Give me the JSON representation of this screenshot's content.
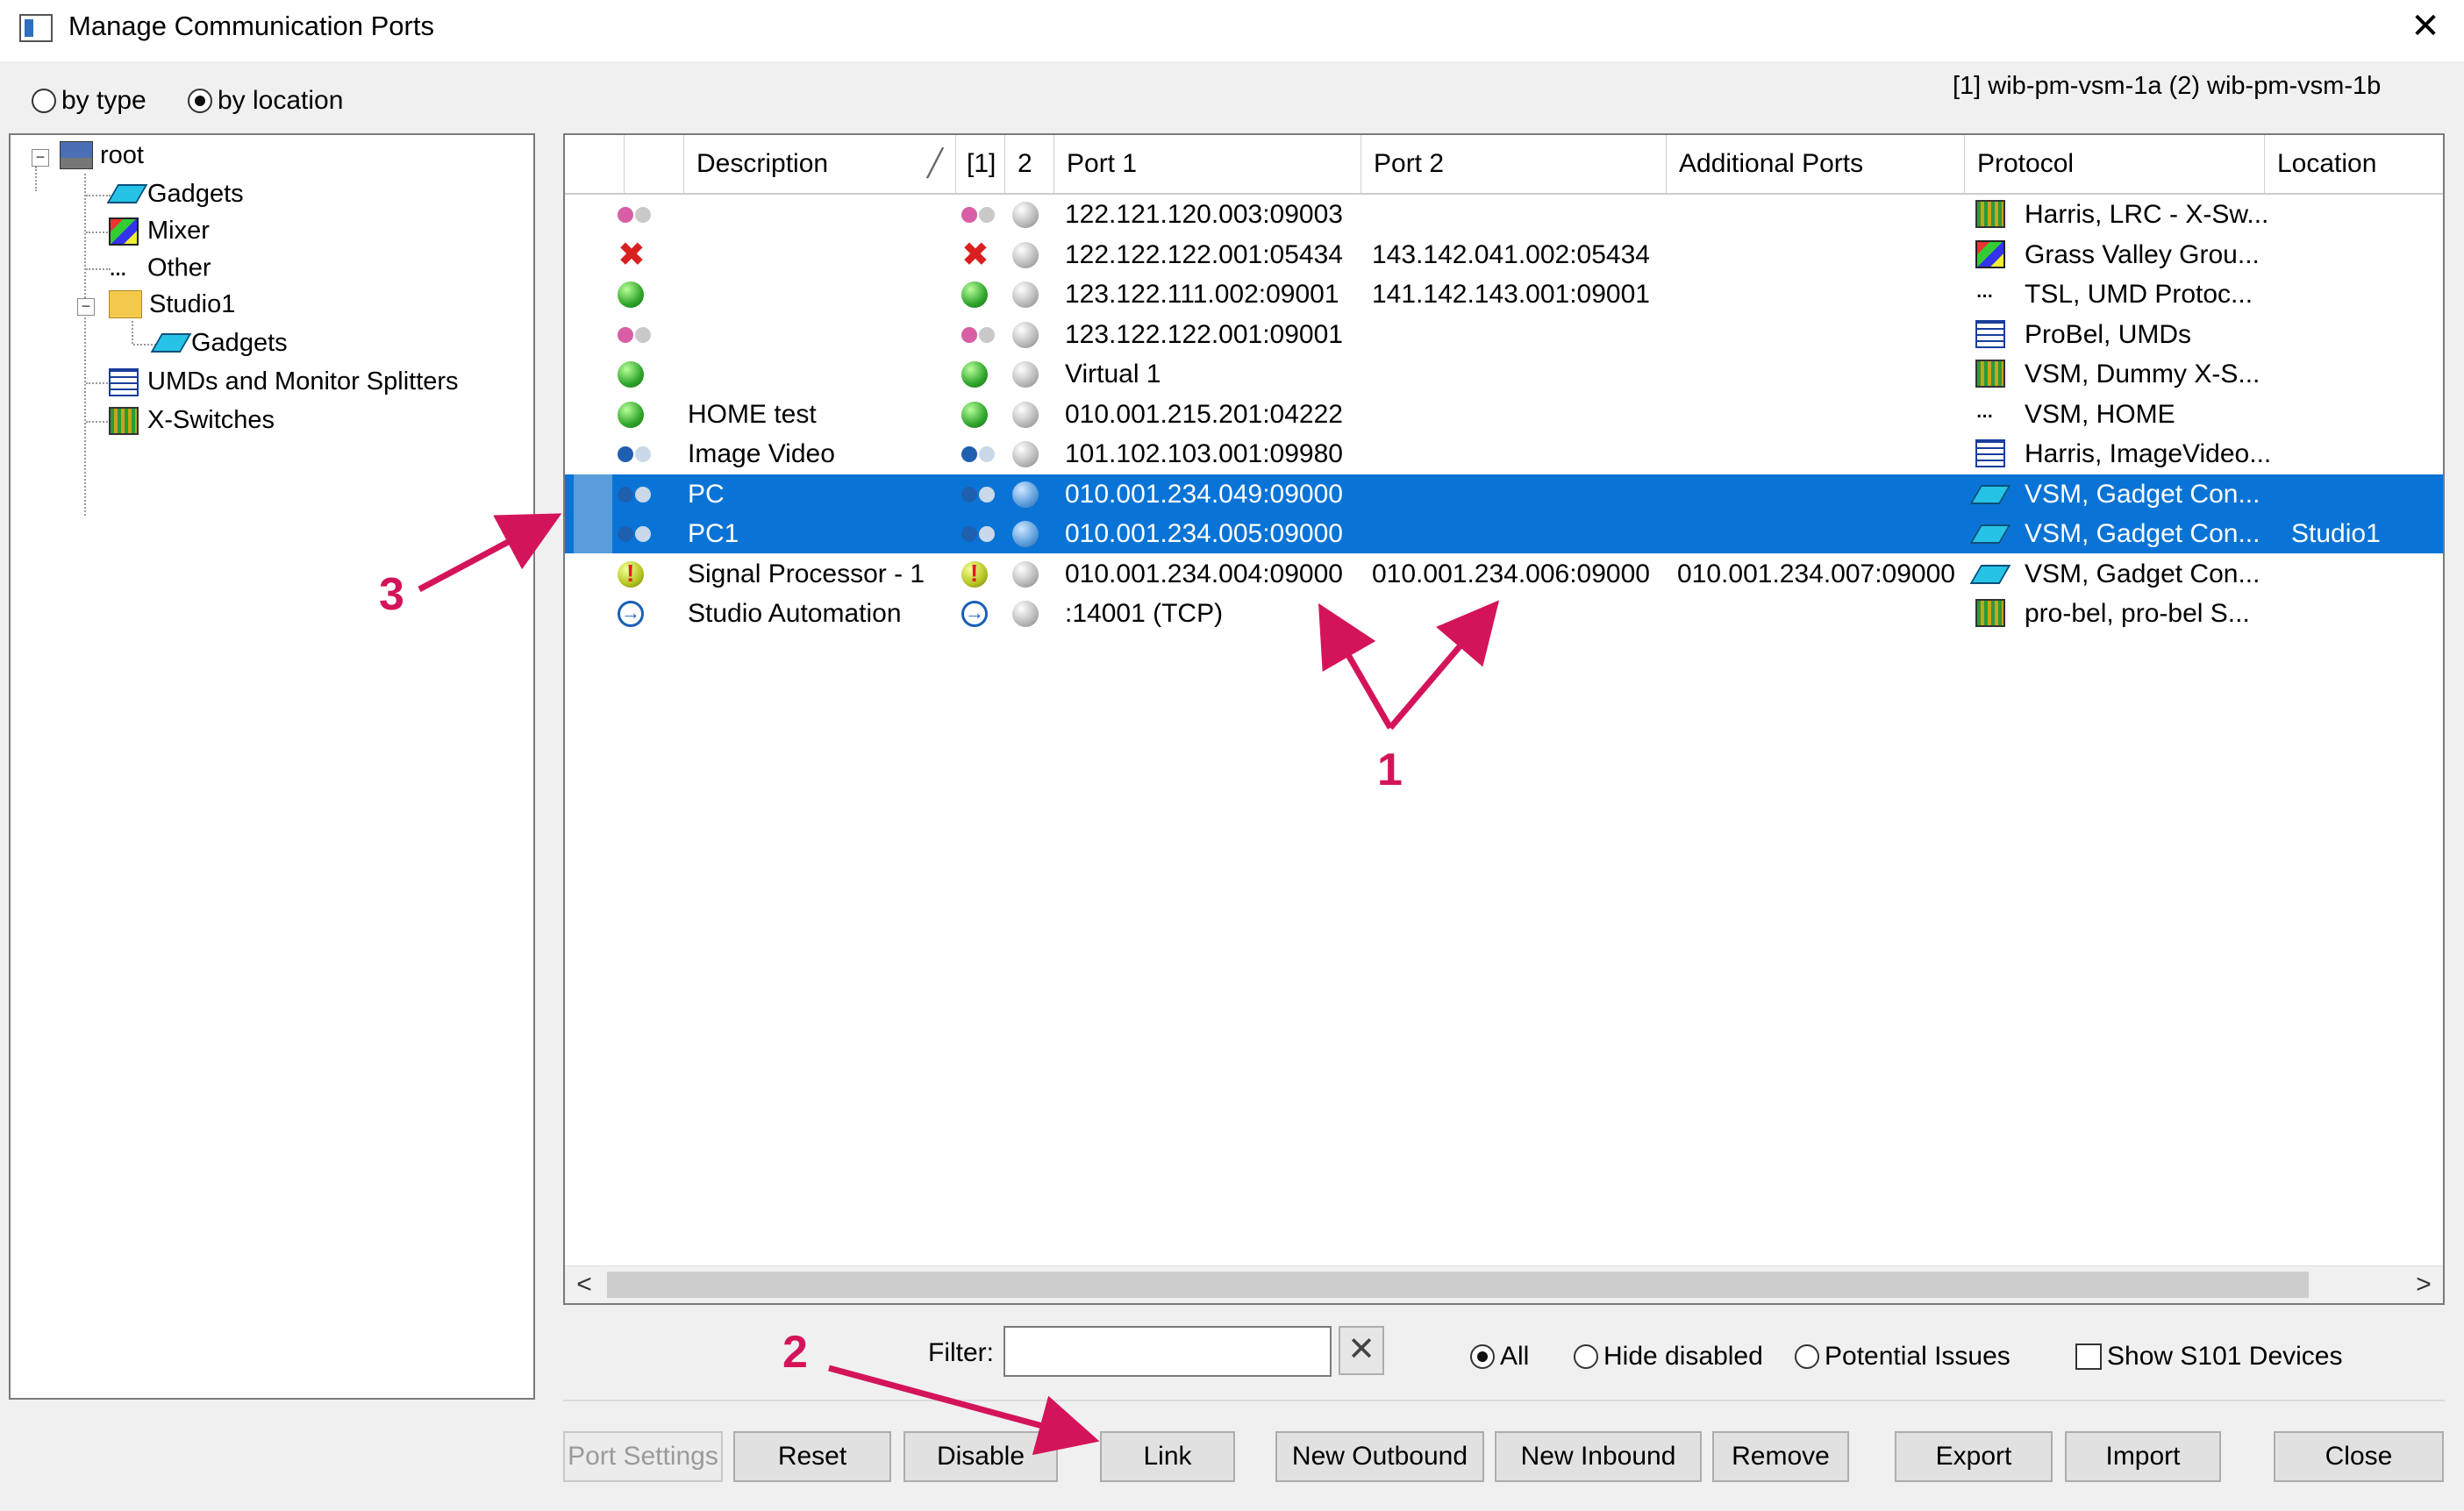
{
  "window": {
    "title": "Manage Communication Ports",
    "close_glyph": "✕"
  },
  "view_mode": {
    "by_type": "by type",
    "by_location": "by location",
    "selected": "by_location"
  },
  "servers": "[1] wib-pm-vsm-1a  (2) wib-pm-vsm-1b",
  "tree": {
    "root": "root",
    "gadgets": "Gadgets",
    "mixer": "Mixer",
    "other": "Other",
    "studio1": "Studio1",
    "studio1_gadgets": "Gadgets",
    "umds": "UMDs and Monitor Splitters",
    "xswitches": "X-Switches"
  },
  "columns": {
    "description": "Description",
    "sort_glyph": "╱",
    "server1": "[1]",
    "server2": "2",
    "port1": "Port 1",
    "port2": "Port 2",
    "additional": "Additional Ports",
    "protocol": "Protocol",
    "location": "Location"
  },
  "rows": [
    {
      "status": "pinkpair",
      "s1": "pinkpair",
      "s2": "grey",
      "description": "",
      "port1": "122.121.120.003:09003",
      "port2": "",
      "additional": "",
      "picon": "matrix",
      "protocol": "Harris, LRC - X-Sw...",
      "location": "",
      "selected": false
    },
    {
      "status": "redx",
      "s1": "redx",
      "s2": "grey",
      "description": "",
      "port1": "122.122.122.001:05434",
      "port2": "143.142.041.002:05434",
      "additional": "",
      "picon": "mixer",
      "protocol": "Grass Valley Grou...",
      "location": "",
      "selected": false
    },
    {
      "status": "green",
      "s1": "green",
      "s2": "grey",
      "description": "",
      "port1": "123.122.111.002:09001",
      "port2": "141.142.143.001:09001",
      "additional": "",
      "picon": "dots",
      "protocol": "TSL, UMD Protoc...",
      "location": "",
      "selected": false
    },
    {
      "status": "pinkpair",
      "s1": "pinkpair",
      "s2": "grey",
      "description": "",
      "port1": "123.122.122.001:09001",
      "port2": "",
      "additional": "",
      "picon": "umd",
      "protocol": "ProBel, UMDs",
      "location": "",
      "selected": false
    },
    {
      "status": "green",
      "s1": "green",
      "s2": "grey",
      "description": "",
      "port1": "Virtual 1",
      "port2": "",
      "additional": "",
      "picon": "matrix",
      "protocol": "VSM, Dummy X-S...",
      "location": "",
      "selected": false
    },
    {
      "status": "green",
      "s1": "green",
      "s2": "grey",
      "description": "HOME test",
      "port1": "010.001.215.201:04222",
      "port2": "",
      "additional": "",
      "picon": "dots",
      "protocol": "VSM, HOME",
      "location": "",
      "selected": false
    },
    {
      "status": "bluepair",
      "s1": "bluepair",
      "s2": "grey",
      "description": "Image Video",
      "port1": "101.102.103.001:09980",
      "port2": "",
      "additional": "",
      "picon": "umd",
      "protocol": "Harris, ImageVideo...",
      "location": "",
      "selected": false
    },
    {
      "status": "bluepair",
      "s1": "bluepair",
      "s2": "blue",
      "description": "PC",
      "port1": "010.001.234.049:09000",
      "port2": "",
      "additional": "",
      "picon": "gadget",
      "protocol": "VSM, Gadget Con...",
      "location": "",
      "selected": true
    },
    {
      "status": "bluepair",
      "s1": "bluepair",
      "s2": "blue",
      "description": "PC1",
      "port1": "010.001.234.005:09000",
      "port2": "",
      "additional": "",
      "picon": "gadget",
      "protocol": "VSM, Gadget Con...",
      "location": "Studio1",
      "selected": true
    },
    {
      "status": "warn",
      "s1": "warn",
      "s2": "grey",
      "description": "Signal Processor - 1",
      "port1": "010.001.234.004:09000",
      "port2": "010.001.234.006:09000",
      "additional": "010.001.234.007:09000",
      "picon": "gadget",
      "protocol": "VSM, Gadget Con...",
      "location": "",
      "selected": false
    },
    {
      "status": "arrow",
      "s1": "arrow",
      "s2": "grey",
      "description": "Studio Automation",
      "port1": ":14001 (TCP)",
      "port2": "",
      "additional": "",
      "picon": "matrix",
      "protocol": "pro-bel, pro-bel S...",
      "location": "",
      "selected": false
    }
  ],
  "scroll": {
    "left": "<",
    "right": ">"
  },
  "filter": {
    "label": "Filter:",
    "value": "",
    "clear_glyph": "✕"
  },
  "visibility": {
    "all": "All",
    "hide_disabled": "Hide disabled",
    "potential_issues": "Potential Issues",
    "selected": "all"
  },
  "show_s101": {
    "label": "Show S101 Devices",
    "checked": false
  },
  "buttons": {
    "port_settings": "Port Settings",
    "reset": "Reset",
    "disable": "Disable",
    "link": "Link",
    "new_outbound": "New Outbound",
    "new_inbound": "New Inbound",
    "remove": "Remove",
    "export": "Export",
    "import": "Import",
    "close": "Close"
  },
  "annotations": {
    "a1": "1",
    "a2": "2",
    "a3": "3"
  },
  "colors": {
    "selection": "#0a74d6",
    "annotation": "#d4145a"
  }
}
